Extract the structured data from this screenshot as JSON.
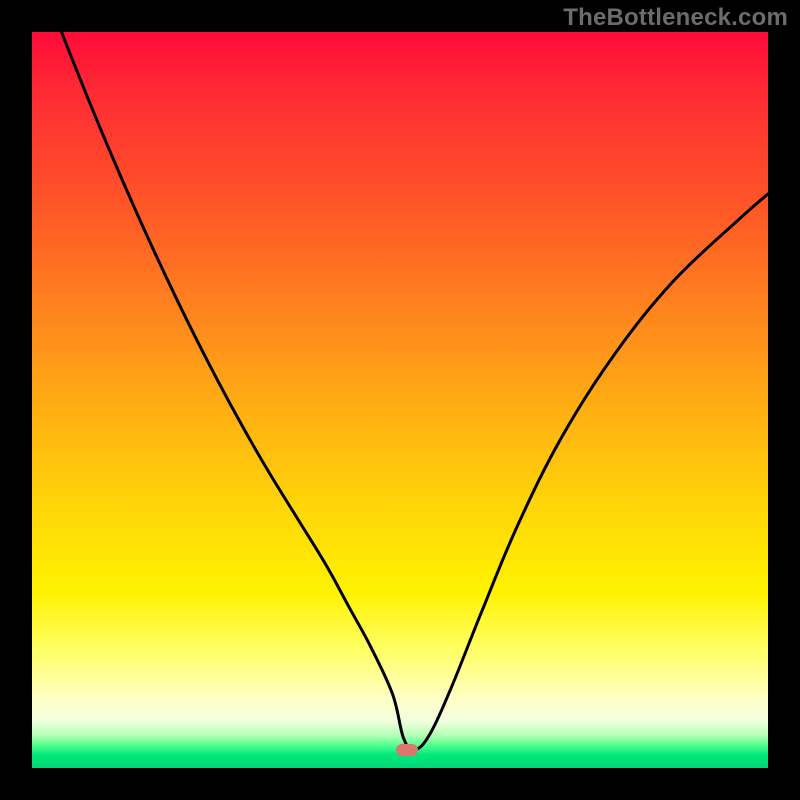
{
  "watermark": "TheBottleneck.com",
  "chart_data": {
    "type": "line",
    "title": "",
    "xlabel": "",
    "ylabel": "",
    "xlim": [
      0,
      100
    ],
    "ylim": [
      0,
      100
    ],
    "grid": false,
    "legend": false,
    "background": "red-yellow-green vertical gradient",
    "series": [
      {
        "name": "bottleneck-curve",
        "x": [
          4,
          8,
          12,
          16,
          20,
          24,
          28,
          32,
          36,
          40,
          43,
          46,
          49,
          50.5,
          52,
          54,
          57,
          61,
          66,
          72,
          79,
          87,
          96,
          100
        ],
        "values": [
          100,
          90,
          80.5,
          71.5,
          63,
          55,
          47.5,
          40.5,
          34,
          27.5,
          22,
          16.5,
          10,
          4,
          2.5,
          4.5,
          11,
          21,
          33,
          45,
          56,
          66,
          74.5,
          78
        ]
      }
    ],
    "markers": [
      {
        "name": "optimal-point",
        "x": 51,
        "y": 2.5,
        "color": "#d9776d"
      }
    ]
  }
}
